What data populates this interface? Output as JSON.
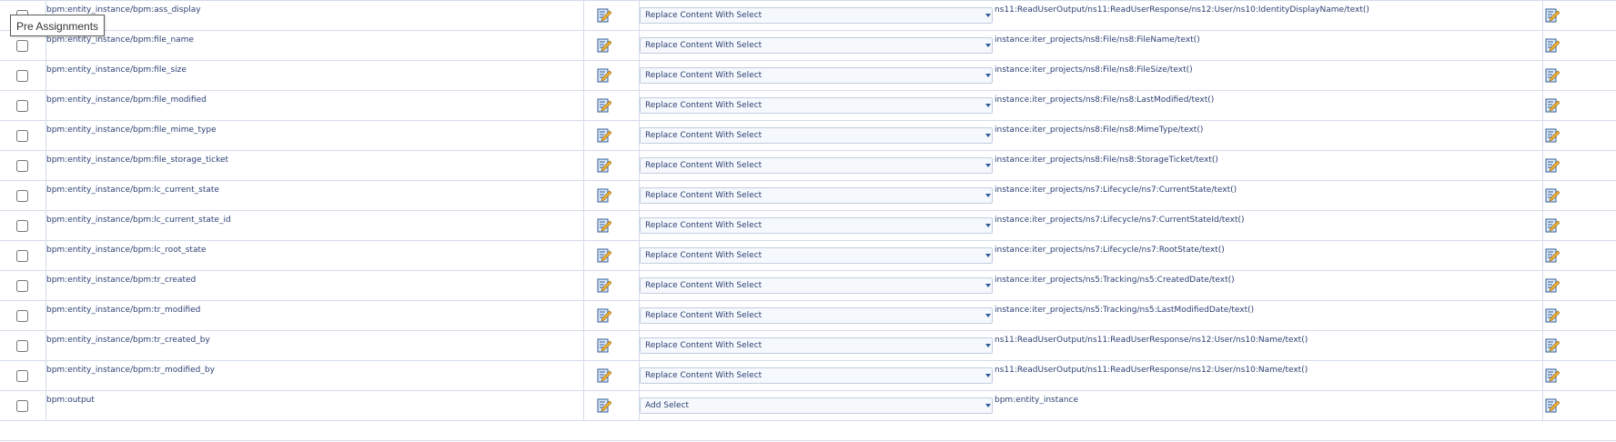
{
  "tooltip": "Pre Assignments",
  "rows": [
    {
      "name": "bpm:entity_instance/bpm:ass_display",
      "select": "Replace Content With Select",
      "path": "ns11:ReadUserOutput/ns11:ReadUserResponse/ns12:User/ns10:IdentityDisplayName/text()"
    },
    {
      "name": "bpm:entity_instance/bpm:file_name",
      "select": "Replace Content With Select",
      "path": "instance:iter_projects/ns8:File/ns8:FileName/text()"
    },
    {
      "name": "bpm:entity_instance/bpm:file_size",
      "select": "Replace Content With Select",
      "path": "instance:iter_projects/ns8:File/ns8:FileSize/text()"
    },
    {
      "name": "bpm:entity_instance/bpm:file_modified",
      "select": "Replace Content With Select",
      "path": "instance:iter_projects/ns8:File/ns8:LastModified/text()"
    },
    {
      "name": "bpm:entity_instance/bpm:file_mime_type",
      "select": "Replace Content With Select",
      "path": "instance:iter_projects/ns8:File/ns8:MimeType/text()"
    },
    {
      "name": "bpm:entity_instance/bpm:file_storage_ticket",
      "select": "Replace Content With Select",
      "path": "instance:iter_projects/ns8:File/ns8:StorageTicket/text()"
    },
    {
      "name": "bpm:entity_instance/bpm:lc_current_state",
      "select": "Replace Content With Select",
      "path": "instance:iter_projects/ns7:Lifecycle/ns7:CurrentState/text()"
    },
    {
      "name": "bpm:entity_instance/bpm:lc_current_state_id",
      "select": "Replace Content With Select",
      "path": "instance:iter_projects/ns7:Lifecycle/ns7:CurrentStateId/text()"
    },
    {
      "name": "bpm:entity_instance/bpm:lc_root_state",
      "select": "Replace Content With Select",
      "path": "instance:iter_projects/ns7:Lifecycle/ns7:RootState/text()"
    },
    {
      "name": "bpm:entity_instance/bpm:tr_created",
      "select": "Replace Content With Select",
      "path": "instance:iter_projects/ns5:Tracking/ns5:CreatedDate/text()"
    },
    {
      "name": "bpm:entity_instance/bpm:tr_modified",
      "select": "Replace Content With Select",
      "path": "instance:iter_projects/ns5:Tracking/ns5:LastModifiedDate/text()"
    },
    {
      "name": "bpm:entity_instance/bpm:tr_created_by",
      "select": "Replace Content With Select",
      "path": "ns11:ReadUserOutput/ns11:ReadUserResponse/ns12:User/ns10:Name/text()"
    },
    {
      "name": "bpm:entity_instance/bpm:tr_modified_by",
      "select": "Replace Content With Select",
      "path": "ns11:ReadUserOutput/ns11:ReadUserResponse/ns12:User/ns10:Name/text()"
    },
    {
      "name": "bpm:output",
      "select": "Add Select",
      "path": "bpm:entity_instance"
    }
  ],
  "icons": {
    "edit_xpath": "edit-pencil-icon",
    "edit_expression": "edit-pencil-icon"
  }
}
